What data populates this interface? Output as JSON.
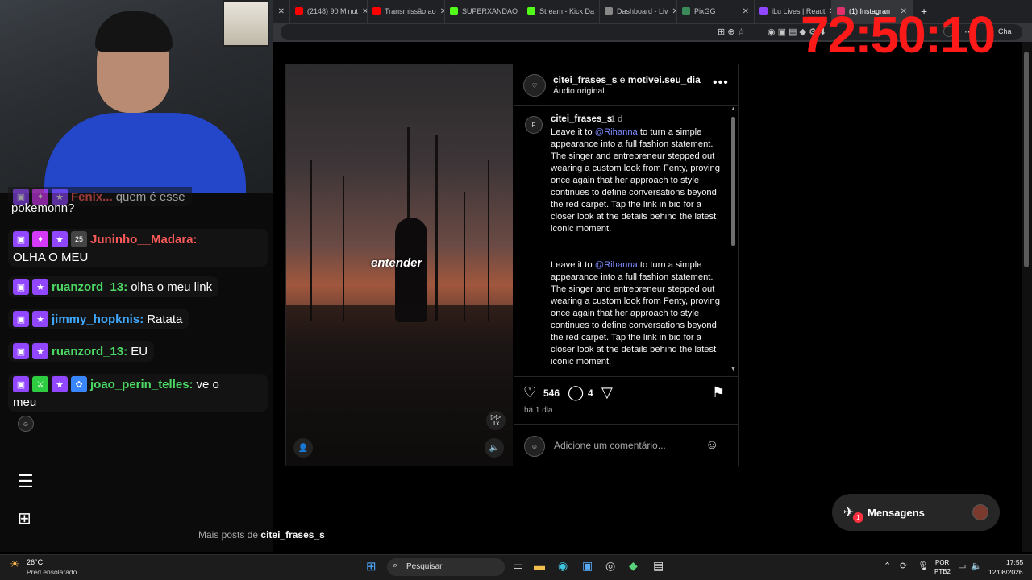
{
  "browser": {
    "tabs": [
      {
        "label": "(2148) 90 Minut",
        "color": "#ff0000"
      },
      {
        "label": "Transmissão ao",
        "color": "#ff0000"
      },
      {
        "label": "SUPERXANDAO",
        "color": "#53fc18"
      },
      {
        "label": "Stream - Kick Da",
        "color": "#53fc18"
      },
      {
        "label": "Dashboard - Liv",
        "color": "#888888"
      },
      {
        "label": "PixGG",
        "color": "#3a8a5a"
      },
      {
        "label": "iLu Lives | React",
        "color": "#9146ff"
      },
      {
        "label": "(1) Instagran",
        "color": "#e1306c"
      }
    ],
    "new_tab": "+",
    "profile_label": "Cha"
  },
  "overlay": {
    "timer": "72:50:10"
  },
  "chat": {
    "partial_top": {
      "user": "Fenix...",
      "text": "quem é esse",
      "cont": "pokemonn?"
    },
    "messages": [
      {
        "user": "Juninho__Madara:",
        "text": "OLHA O MEU",
        "user_color": "#ff5a5a",
        "badges": [
          "twitch",
          "gem",
          "star",
          "25"
        ]
      },
      {
        "user": "ruanzord_13:",
        "text": "olha o meu link",
        "user_color": "#4cd964",
        "badges": [
          "twitch",
          "star"
        ]
      },
      {
        "user": "jimmy_hopknis:",
        "text": "Ratata",
        "user_color": "#3fa9ff",
        "badges": [
          "twitch",
          "star"
        ]
      },
      {
        "user": "ruanzord_13:",
        "text": "EU",
        "user_color": "#4cd964",
        "badges": [
          "twitch",
          "star"
        ]
      },
      {
        "user": "joao_perin_telles:",
        "text": "ve o",
        "cont": "meu",
        "user_color": "#4cd964",
        "badges": [
          "twitch",
          "green",
          "star",
          "flower"
        ]
      }
    ]
  },
  "post": {
    "header_user1": "citei_frases_s",
    "header_sep": "e",
    "header_user2": "motivei.seu_dia",
    "audio": "Áudio original",
    "video_caption": "entender",
    "speed_label": "1x",
    "caption_user": "citei_frases_s",
    "caption_time": "1 d",
    "caption_pre": "Leave it to ",
    "mention": "@Rihanna",
    "caption_post": " to turn a simple appearance into a full fashion statement. The singer and entrepreneur stepped out wearing a custom look from Fenty, proving once again that her approach to style continues to define conversations beyond the red carpet. Tap the link in bio for a closer look at the details behind the latest iconic moment.",
    "likes": "546",
    "comments": "4",
    "posted": "há 1 dia",
    "comment_placeholder": "Adicione um comentário..."
  },
  "more_posts": {
    "prefix": "Mais posts de",
    "user": "citei_frases_s"
  },
  "messages_button": {
    "label": "Mensagens",
    "badge": "1"
  },
  "taskbar": {
    "temp": "26°C",
    "weather": "Pred ensolarado",
    "search": "Pesquisar",
    "lang1": "POR",
    "lang2": "PTB2",
    "time": "17:55",
    "date": "12/08/2026"
  }
}
